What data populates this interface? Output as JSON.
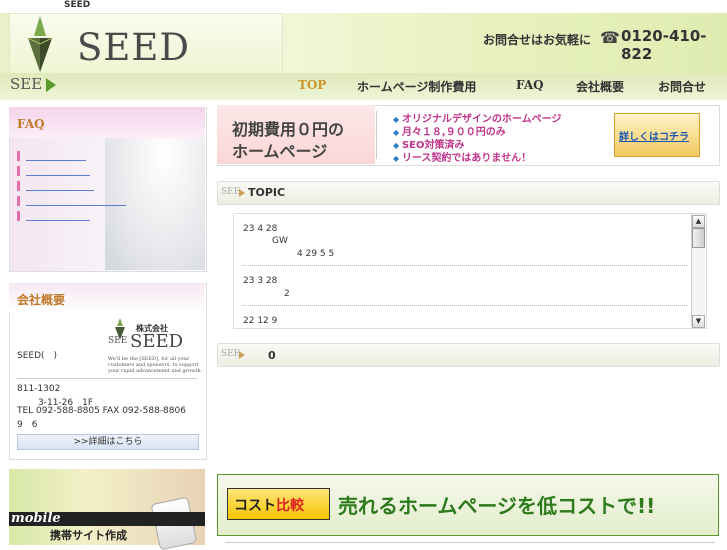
{
  "site_label": "SEED",
  "header": {
    "logo_text": "SEED",
    "logo_sub": "SEE",
    "contact_text": "お問合せはお気軽に",
    "phone_icon": "☎",
    "phone_number": "0120-410-822"
  },
  "nav": {
    "top": "TOP",
    "hp": "ホームページ制作費用",
    "faq": "FAQ",
    "company": "会社概要",
    "contact": "お問合せ"
  },
  "faq": {
    "title": "FAQ"
  },
  "company": {
    "title": "会社概要",
    "logo_kaisha": "株式会社",
    "logo_seed": "SEED",
    "logo_see": "SEE",
    "slogan": "We'll be the [SEED], for all your customers and sponsors, to support your rapid advancement and growth.",
    "name": "SEED(　)",
    "zip": "811-1302",
    "address": "3-11-26　1F",
    "tel_fax": "TEL 092-588-8805  FAX 092-588-8806",
    "hours": "9　6",
    "detail_button": ">>詳細はこちら"
  },
  "mobile": {
    "label": "mobile",
    "sub": "携帯サイト作成"
  },
  "banner": {
    "title1": "初期費用０円の",
    "title2": "ホームページ",
    "bullets": [
      "オリジナルデザインのホームページ",
      "月々１８,９００円のみ",
      "SEO対策済み",
      "リース契約ではありません！"
    ],
    "button": "詳しくはコチラ"
  },
  "topic": {
    "see": "SEE",
    "title": "TOPIC",
    "items": [
      {
        "date": "23 4 28",
        "line2": "GW",
        "line3": "4 29  5 5"
      },
      {
        "date": "23 3 28",
        "line2": "2",
        "line3": ""
      },
      {
        "date": "22 12 9",
        "line2": "",
        "line3": ""
      }
    ],
    "scroll_up": "▲",
    "scroll_down": "▼"
  },
  "news": {
    "see": "SEE",
    "count": "0"
  },
  "cost": {
    "label_a": "コスト",
    "label_b": "比較",
    "text": "売れるホームページを低コストで!!"
  }
}
